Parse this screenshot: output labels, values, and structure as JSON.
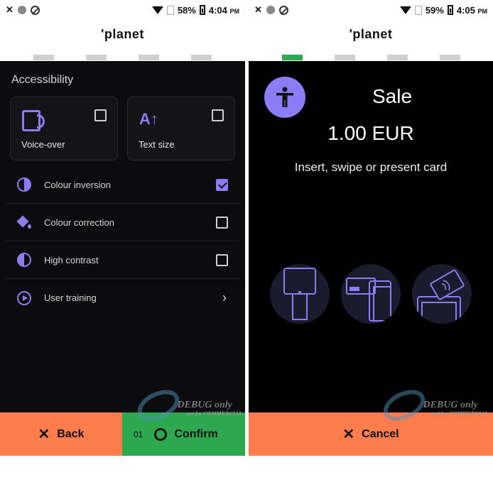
{
  "left_screen": {
    "status_bar": {
      "battery": "58%",
      "time": "4:04",
      "ampm": "PM"
    },
    "brand": "'planet",
    "progress": {
      "steps": 4,
      "active": -1
    },
    "section_title": "Accessibility",
    "cards": [
      {
        "label": "Voice-over",
        "icon": "speaker-document-icon",
        "checked": false
      },
      {
        "label": "Text size",
        "icon": "text-size-icon",
        "icon_text": "A↑",
        "checked": false
      }
    ],
    "rows": [
      {
        "label": "Colour inversion",
        "icon": "colour-inversion-icon",
        "checked": true
      },
      {
        "label": "Colour correction",
        "icon": "paint-bucket-icon",
        "checked": false
      },
      {
        "label": "High contrast",
        "icon": "contrast-icon",
        "checked": false
      },
      {
        "label": "User training",
        "icon": "play-circle-icon",
        "chevron": "›"
      }
    ],
    "footer": {
      "back_label": "Back",
      "confirm_count": "01",
      "confirm_label": "Confirm"
    },
    "watermark": {
      "text": "DEBUG only",
      "sub": "not for COMMERCIAL"
    }
  },
  "right_screen": {
    "status_bar": {
      "battery": "59%",
      "time": "4:05",
      "ampm": "PM"
    },
    "brand": "'planet",
    "progress": {
      "steps": 4,
      "active": 0
    },
    "accessibility_icon": "accessibility-person-icon",
    "title": "Sale",
    "amount": "1.00 EUR",
    "instruction": "Insert, swipe or present card",
    "payment_methods": [
      "insert-card-icon",
      "swipe-card-icon",
      "contactless-card-icon"
    ],
    "footer": {
      "cancel_label": "Cancel"
    },
    "watermark": {
      "text": "DEBUG only",
      "sub": "not for COMMERCIAL"
    }
  },
  "colors": {
    "accent": "#8c7cf5",
    "back_orange": "#fd7d4d",
    "confirm_green": "#2ea84f",
    "dark_bg": "#0c0c0e"
  }
}
